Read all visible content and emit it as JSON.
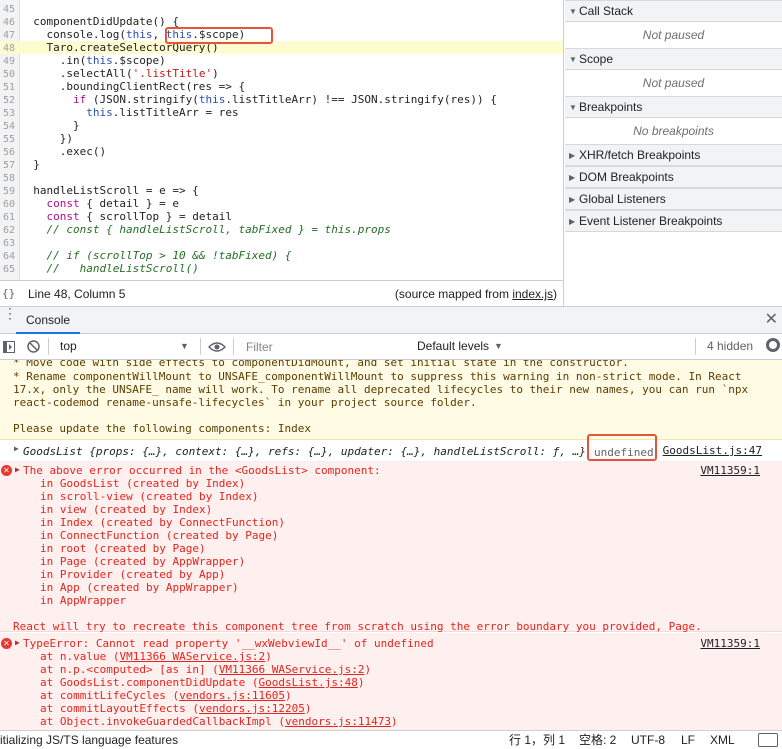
{
  "source": {
    "lines": [
      {
        "n": "45",
        "text": ""
      },
      {
        "n": "46",
        "text": "  componentDidUpdate() {"
      },
      {
        "n": "47",
        "text": "    console.log(this, this.$scope)"
      },
      {
        "n": "48",
        "text": "    Taro.createSelectorQuery()"
      },
      {
        "n": "49",
        "text": "      .in(this.$scope)"
      },
      {
        "n": "50",
        "text": "      .selectAll('.listTitle')"
      },
      {
        "n": "51",
        "text": "      .boundingClientRect(res => {"
      },
      {
        "n": "52",
        "text": "        if (JSON.stringify(this.listTitleArr) !== JSON.stringify(res)) {"
      },
      {
        "n": "53",
        "text": "          this.listTitleArr = res"
      },
      {
        "n": "54",
        "text": "        }"
      },
      {
        "n": "55",
        "text": "      })"
      },
      {
        "n": "56",
        "text": "      .exec()"
      },
      {
        "n": "57",
        "text": "  }"
      },
      {
        "n": "58",
        "text": ""
      },
      {
        "n": "59",
        "text": "  handleListScroll = e => {"
      },
      {
        "n": "60",
        "text": "    const { detail } = e"
      },
      {
        "n": "61",
        "text": "    const { scrollTop } = detail"
      },
      {
        "n": "62",
        "text": "    // const { handleListScroll, tabFixed } = this.props"
      },
      {
        "n": "63",
        "text": ""
      },
      {
        "n": "64",
        "text": "    // if (scrollTop > 10 && !tabFixed) {"
      },
      {
        "n": "65",
        "text": "    //   handleListScroll()"
      }
    ],
    "status_braces": "{}",
    "status_position": "Line 48, Column 5",
    "status_source_prefix": "(source mapped from ",
    "status_source_link": "index.js",
    "status_source_suffix": ")"
  },
  "sidebar": {
    "panes": [
      {
        "title": "Call Stack",
        "body": "Not paused"
      },
      {
        "title": "Scope",
        "body": "Not paused"
      },
      {
        "title": "Breakpoints",
        "body": "No breakpoints"
      },
      {
        "title": "XHR/fetch Breakpoints"
      },
      {
        "title": "DOM Breakpoints"
      },
      {
        "title": "Global Listeners"
      },
      {
        "title": "Event Listener Breakpoints"
      }
    ]
  },
  "console": {
    "tab_label": "Console",
    "context": "top",
    "filter_placeholder": "Filter",
    "levels": "Default levels",
    "hidden": "4 hidden",
    "warning_lines": [
      "* Move code with side effects to componentDidMount, and set initial state in the constructor.",
      "* Rename componentWillMount to UNSAFE_componentWillMount to suppress this warning in non-strict mode. In React",
      "17.x, only the UNSAFE_ name will work. To rename all deprecated lifecycles to their new names, you can run `npx",
      "react-codemod rename-unsafe-lifecycles` in your project source folder.",
      "",
      "Please update the following components: Index"
    ],
    "log_text": "GoodsList {props: {…}, context: {…}, refs: {…}, updater: {…}, handleListScroll: ƒ, …}",
    "log_undefined": "undefined",
    "log_link": "GoodsList.js:47",
    "error1": {
      "head": "The above error occurred in the <GoodsList> component:",
      "link": "VM11359:1",
      "lines": [
        "in GoodsList (created by Index)",
        "in scroll-view (created by Index)",
        "in view (created by Index)",
        "in Index (created by ConnectFunction)",
        "in ConnectFunction (created by Page)",
        "in root (created by Page)",
        "in Page (created by AppWrapper)",
        "in Provider (created by App)",
        "in App (created by AppWrapper)",
        "in AppWrapper"
      ],
      "tail": "React will try to recreate this component tree from scratch using the error boundary you provided, Page."
    },
    "error2": {
      "head": "TypeError: Cannot read property '__wxWebviewId__' of undefined",
      "link": "VM11359:1",
      "frames": [
        {
          "pre": "at n.value (",
          "link": "VM11366 WAService.js:2",
          "post": ")"
        },
        {
          "pre": "at n.p.<computed> [as in] (",
          "link": "VM11366 WAService.js:2",
          "post": ")"
        },
        {
          "pre": "at GoodsList.componentDidUpdate (",
          "link": "GoodsList.js:48",
          "post": ")"
        },
        {
          "pre": "at commitLifeCycles (",
          "link": "vendors.js:11605",
          "post": ")"
        },
        {
          "pre": "at commitLayoutEffects (",
          "link": "vendors.js:12205",
          "post": ")"
        },
        {
          "pre": "at Object.invokeGuardedCallbackImpl (",
          "link": "vendors.js:11473",
          "post": ")"
        }
      ]
    }
  },
  "editor_status": {
    "left": "itializing JS/TS language features",
    "cursor": "行 1，列 1",
    "spaces": "空格: 2",
    "encoding": "UTF-8",
    "eol": "LF",
    "lang": "XML"
  }
}
